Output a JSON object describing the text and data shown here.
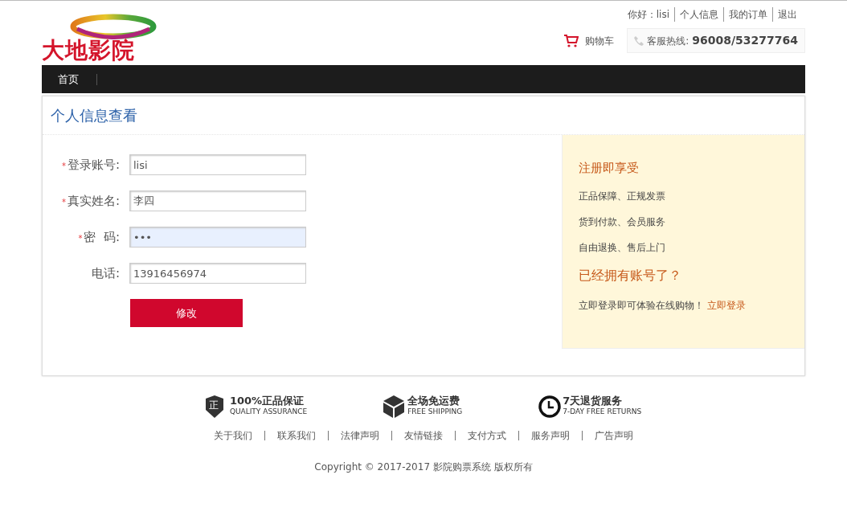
{
  "header": {
    "logo_text": "大地影院",
    "greeting": "你好：lisi",
    "top_links": [
      "个人信息",
      "我的订单",
      "退出"
    ],
    "cart": "购物车",
    "hotline_label": "客服热线:",
    "hotline_number": "96008/53277764"
  },
  "nav": {
    "items": [
      {
        "label": "首页",
        "selected": true
      }
    ]
  },
  "panel": {
    "title": "个人信息查看",
    "fields": [
      {
        "label": "登录账号:",
        "required": true,
        "value": "lisi",
        "kind": "text"
      },
      {
        "label": "真实姓名:",
        "required": true,
        "value": "李四",
        "kind": "text"
      },
      {
        "label": "密  码:",
        "required": true,
        "value": "•••",
        "kind": "password"
      },
      {
        "label": "电话:",
        "required": false,
        "value": "13916456974",
        "kind": "text"
      }
    ],
    "required_mark": "*",
    "submit": "修改",
    "aside": {
      "heading": "注册即享受",
      "benefits": [
        "正品保障、正规发票",
        "货到付款、会员服务",
        "自由退换、售后上门"
      ],
      "login_heading": "已经拥有账号了？",
      "login_text": "立即登录即可体验在线购物！",
      "login_link": "立即登录"
    }
  },
  "guarantees": [
    {
      "kind": "shield",
      "icon_text": "正",
      "title": "100%正品保证",
      "subtitle": "QUALITY ASSURANCE"
    },
    {
      "kind": "box",
      "title": "全场免运费",
      "subtitle": "FREE SHIPPING"
    },
    {
      "kind": "clock",
      "title": "7天退货服务",
      "subtitle": "7-DAY FREE RETURNS"
    }
  ],
  "footer_links": [
    "关于我们",
    "联系我们",
    "法律声明",
    "友情链接",
    "支付方式",
    "服务声明",
    "广告声明"
  ],
  "copyright": "Copyright © 2017-2017 影院购票系统 版权所有"
}
